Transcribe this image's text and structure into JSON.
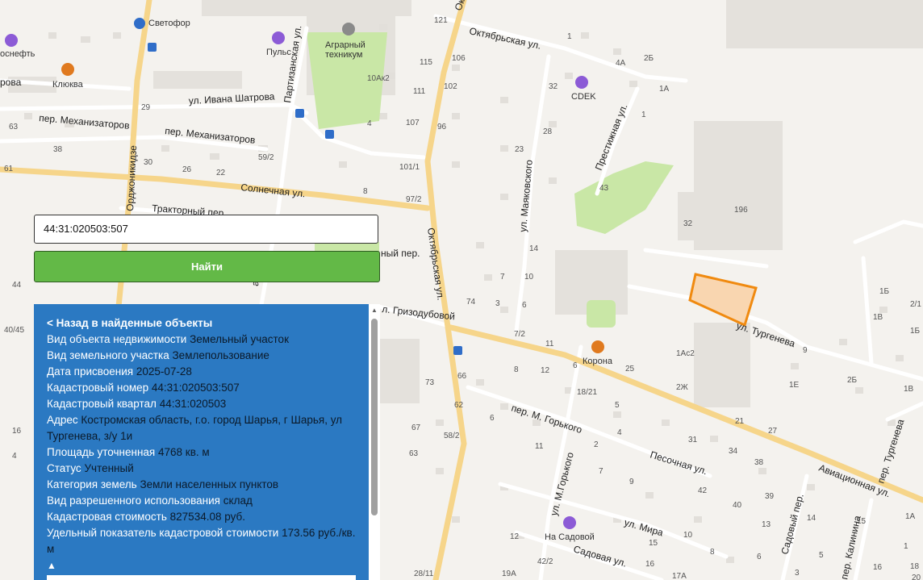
{
  "map": {
    "streets": {
      "ivana_shatrova": "ул. Ивана Шатрова",
      "mekhanizatorov_1": "пер. Механизаторов",
      "mekhanizatorov_2": "пер. Механизаторов",
      "solnechnaya": "Солнечная ул.",
      "traktorny": "Тракторный пер.",
      "ordzhonikidze": "Орджоникидзе",
      "partizanskaya": "Партизанская ул.",
      "oktyabrskaya_top": "Октябрьская ул.",
      "oktyabrskaya_mid": "Октябрьская ул.",
      "oktyabrskaya_bottom": "Октябрьская ул.",
      "mayakovskogo": "ул. Маяковского",
      "prestizhnaya": "Престижная ул.",
      "turgeneva": "ул. Тургенева",
      "turgeneva_per": "пер. Тургенева",
      "grizodubovoy": "л. Гризодубовой",
      "m_gorkogo_per": "пер. М. Горького",
      "m_gorkogo_ul": "ул. М.Горького",
      "pesochnaya": "Песочная ул.",
      "aviatsionnaya": "Авиационная ул.",
      "mira": "ул. Мира",
      "sadovaya": "Садовая ул.",
      "sadovy_per": "Садовый пер.",
      "kalinina_per": "пер. Калинина",
      "solnechny_per_fragment": "ный пер.",
      "frag_anska": "анска",
      "frag_rova": "рова"
    },
    "pois": {
      "svetofor": "Светофор",
      "rosneft": "оснефть",
      "klyukva": "Клюква",
      "puls": "Пульс",
      "agrarny": "Аграрный",
      "tekhnikum": "техникум",
      "cdek": "CDEK",
      "korona": "Корона",
      "na_sadovoy": "На Садовой"
    },
    "house_numbers": [
      "121",
      "106",
      "115",
      "102",
      "111",
      "107",
      "96",
      "101/1",
      "97/2",
      "59/2",
      "29",
      "30",
      "26",
      "22",
      "8",
      "4",
      "38",
      "63",
      "61",
      "44",
      "40/45",
      "16",
      "4",
      "10Ак2",
      "1",
      "2Б",
      "4А",
      "1А",
      "1",
      "32",
      "28",
      "23",
      "14",
      "10",
      "7",
      "6",
      "3",
      "74",
      "7/2",
      "11",
      "8",
      "12",
      "18/21",
      "6",
      "66",
      "73",
      "67",
      "58/2",
      "63",
      "62",
      "6",
      "11",
      "2",
      "4",
      "5",
      "7",
      "9",
      "12",
      "15",
      "16",
      "17А",
      "19А",
      "28/11",
      "42/2",
      "32",
      "196",
      "1Ас2",
      "2Ж",
      "25",
      "21",
      "27",
      "31",
      "34",
      "38",
      "39",
      "40",
      "42",
      "43",
      "9",
      "1Е",
      "2Б",
      "1Б",
      "1В",
      "2/1",
      "1Б",
      "1В",
      "1А",
      "1",
      "3",
      "5",
      "6",
      "8",
      "10",
      "13",
      "14",
      "15",
      "16",
      "18",
      "20",
      "12",
      "16",
      "25"
    ],
    "colors": {
      "background": "#f4f2ee",
      "major_road": "#f6d58a",
      "green": "#c9e7a6",
      "parcel_fill": "#f9d6b0",
      "parcel_stroke": "#f08a10",
      "poi_blue": "#2f6dc8",
      "poi_orange": "#e07a1f",
      "poi_purple": "#8c5bd6"
    },
    "icons": [
      "bus-stop-icon",
      "store-icon",
      "gas-station-icon",
      "cafe-icon",
      "fitness-icon",
      "school-icon",
      "delivery-icon",
      "restaurant-icon",
      "hotel-icon"
    ]
  },
  "search": {
    "value": "44:31:020503:507",
    "button_label": "Найти"
  },
  "panel": {
    "back_label": "< Назад в найденные объекты",
    "collapse_glyph": "▲",
    "rows": [
      {
        "label": "Вид объекта недвижимости",
        "value": "Земельный участок"
      },
      {
        "label": "Вид земельного участка",
        "value": "Землепользование"
      },
      {
        "label": "Дата присвоения",
        "value": "2025-07-28"
      },
      {
        "label": "Кадастровый номер",
        "value": "44:31:020503:507"
      },
      {
        "label": "Кадастровый квартал",
        "value": "44:31:020503"
      },
      {
        "label": "Адрес",
        "value": "Костромская область, г.о. город Шарья, г Шарья, ул Тургенева, з/у 1и"
      },
      {
        "label": "Площадь уточненная",
        "value": "4768 кв. м"
      },
      {
        "label": "Статус",
        "value": "Учтенный"
      },
      {
        "label": "Категория земель",
        "value": "Земли населенных пунктов"
      },
      {
        "label": "Вид разрешенного использования",
        "value": "склад"
      },
      {
        "label": "Кадастровая стоимость",
        "value": "827534.08 руб."
      },
      {
        "label": "Удельный показатель кадастровой стоимости",
        "value": "173.56 руб./кв. м"
      }
    ]
  }
}
